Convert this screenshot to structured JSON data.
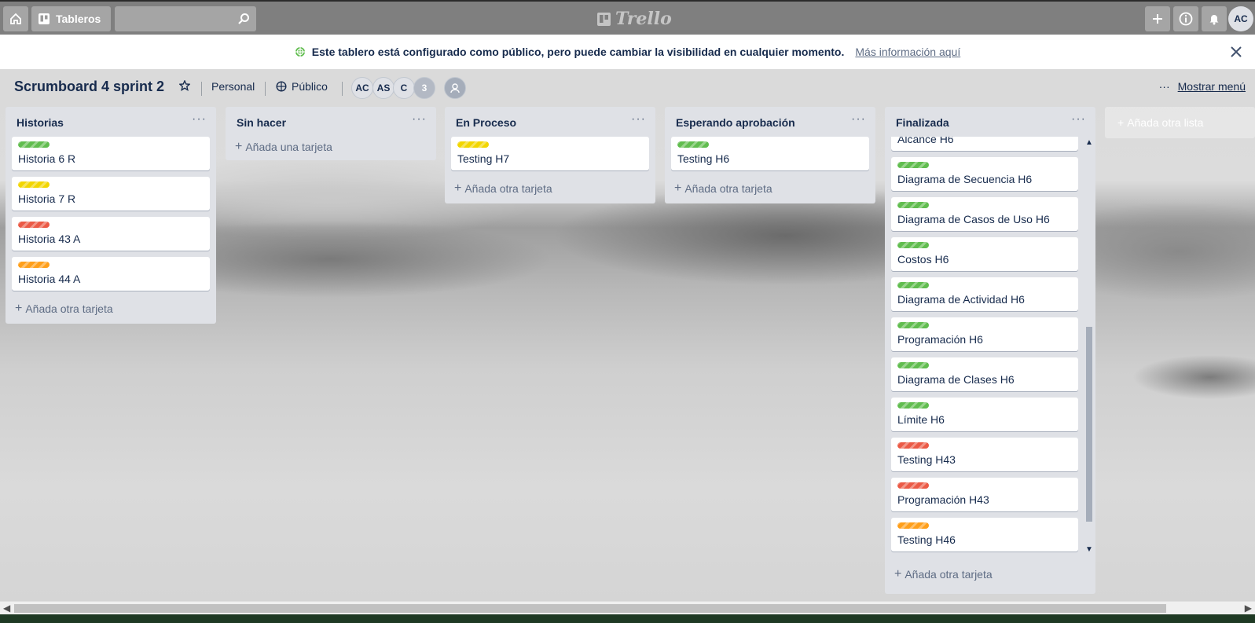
{
  "header": {
    "boards_label": "Tableros",
    "search_placeholder": "",
    "logo_text": "Trello",
    "user_initials": "AC"
  },
  "banner": {
    "message": "Este tablero está configurado como público, pero puede cambiar la visibilidad en cualquier momento.",
    "link": "Más información aquí"
  },
  "board": {
    "title": "Scrumboard 4 sprint 2",
    "team": "Personal",
    "visibility": "Público",
    "members": [
      "AC",
      "AS",
      "C"
    ],
    "extra_members": "3",
    "menu_label": "Mostrar menú"
  },
  "lists": [
    {
      "title": "Historias",
      "cards": [
        {
          "label": "green",
          "title": "Historia 6 R"
        },
        {
          "label": "yellow",
          "title": "Historia 7 R"
        },
        {
          "label": "red",
          "title": "Historia 43 A"
        },
        {
          "label": "orange",
          "title": "Historia 44 A"
        }
      ],
      "add_label": "Añada otra tarjeta"
    },
    {
      "title": "Sin hacer",
      "cards": [],
      "add_label": "Añada una tarjeta"
    },
    {
      "title": "En Proceso",
      "cards": [
        {
          "label": "yellow",
          "title": "Testing H7"
        }
      ],
      "add_label": "Añada otra tarjeta"
    },
    {
      "title": "Esperando aprobación",
      "cards": [
        {
          "label": "green",
          "title": "Testing H6"
        }
      ],
      "add_label": "Añada otra tarjeta"
    },
    {
      "title": "Finalizada",
      "cards": [
        {
          "label": "",
          "title": "Alcance H6"
        },
        {
          "label": "green",
          "title": "Diagrama de Secuencia H6"
        },
        {
          "label": "green",
          "title": "Diagrama de Casos de Uso H6"
        },
        {
          "label": "green",
          "title": "Costos H6"
        },
        {
          "label": "green",
          "title": "Diagrama de Actividad H6"
        },
        {
          "label": "green",
          "title": "Programación H6"
        },
        {
          "label": "green",
          "title": "Diagrama de Clases H6"
        },
        {
          "label": "green",
          "title": "Límite H6"
        },
        {
          "label": "red",
          "title": "Testing H43"
        },
        {
          "label": "red",
          "title": "Programación H43"
        },
        {
          "label": "orange",
          "title": "Testing H46"
        }
      ],
      "add_label": "Añada otra tarjeta"
    }
  ],
  "add_list_label": "Añada otra lista",
  "icons": {
    "home": "home-icon",
    "boards": "boards-icon",
    "search": "search-icon",
    "plus": "plus-icon",
    "info": "info-icon",
    "bell": "bell-icon",
    "globe": "globe-icon",
    "star": "star-icon",
    "close": "close-icon"
  },
  "colors": {
    "header_bg": "#7f7f7f",
    "list_bg": "#dfe1e6",
    "label_green": "#61bd4f",
    "label_yellow": "#f2d600",
    "label_red": "#eb5a46",
    "label_orange": "#ff9f1a"
  }
}
